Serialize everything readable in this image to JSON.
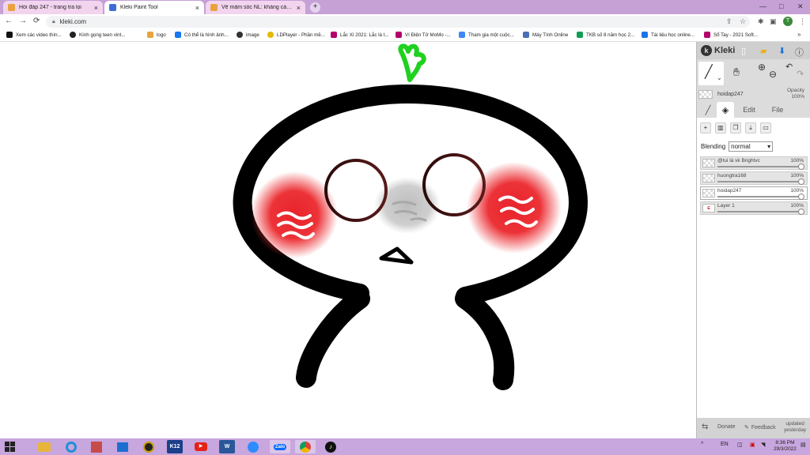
{
  "browser": {
    "tabs": [
      {
        "label": "Hỏi đáp 247 - trang tra lọi",
        "icon": "hoidap-favicon",
        "color": "#e8a33d"
      },
      {
        "label": "Kleki Paint Tool",
        "icon": "kleki-favicon",
        "color": "#3b6fd6"
      },
      {
        "label": "Vẽ mầm sốc NL: kháng cáo chỗ",
        "icon": "hoidap-favicon",
        "color": "#e8a33d"
      }
    ],
    "tab_close": "×",
    "new_tab": "+",
    "url": "kleki.com",
    "profile_initial": "T",
    "window_controls": {
      "minimize": "—",
      "maximize": "□",
      "close": "✕"
    },
    "bookmarks": [
      {
        "label": "Xem các video thín...",
        "color": "#111"
      },
      {
        "label": "Kính gọng teen vint...",
        "color": "#222"
      },
      {
        "label": "logo",
        "color": "#e8a33d"
      },
      {
        "label": "Có thể là hình ảnh...",
        "color": "#1877f2"
      },
      {
        "label": "image",
        "color": "#333"
      },
      {
        "label": "LDPlayer - Phần mề...",
        "color": "#e6b800"
      },
      {
        "label": "Lắc Xì 2021: Lắc là t...",
        "color": "#b5006b"
      },
      {
        "label": "Ví Điện Tử MoMo -...",
        "color": "#b5006b"
      },
      {
        "label": "Tham gia một cuộc...",
        "color": "#4285f4"
      },
      {
        "label": "Máy Tính Online",
        "color": "#4a6fb5"
      },
      {
        "label": "TKB số 8 năm học 2...",
        "color": "#0f9d58"
      },
      {
        "label": "Tài liệu học online...",
        "color": "#1a73e8"
      },
      {
        "label": "Sổ Tay - 2021 Soft...",
        "color": "#b5006b"
      }
    ]
  },
  "kleki": {
    "logo": "Kleki",
    "layer_preview_name": "hoidap247",
    "opacity_label": "Opacity",
    "opacity_value": "100%",
    "tabs": {
      "edit": "Edit",
      "file": "File"
    },
    "blending_label": "Blending",
    "blending_value": "normal",
    "layers": [
      {
        "name": "@tui là vk Brightvc",
        "opacity": "100%",
        "selected": false
      },
      {
        "name": "huongtra168",
        "opacity": "100%",
        "selected": false
      },
      {
        "name": "hoidap247",
        "opacity": "100%",
        "selected": true
      },
      {
        "name": "Layer 1",
        "opacity": "100%",
        "selected": false
      }
    ],
    "footer": {
      "donate": "Donate",
      "feedback": "Feedback",
      "updated": "updated",
      "updated_when": "yesterday"
    }
  },
  "taskbar": {
    "apps": [
      {
        "label": "",
        "icon": "file-explorer-icon",
        "color": "#e8b43a"
      },
      {
        "label": "",
        "icon": "internet-explorer-icon",
        "color": "#1e90d6"
      },
      {
        "label": "",
        "icon": "store-icon",
        "color": "#c84b4b"
      },
      {
        "label": "",
        "icon": "mail-icon",
        "color": "#1c6fd1"
      },
      {
        "label": "",
        "icon": "game-icon",
        "color": "#222"
      },
      {
        "label": "K12",
        "icon": "k12-icon",
        "color": "#1c3f8a"
      },
      {
        "label": "",
        "icon": "youtube-icon",
        "color": "#e62117"
      },
      {
        "label": "W",
        "icon": "word-icon",
        "color": "#2b579a"
      },
      {
        "label": "",
        "icon": "zoom-icon",
        "color": "#2d8cff"
      },
      {
        "label": "Zalo",
        "icon": "zalo-icon",
        "color": "#0068ff"
      },
      {
        "label": "",
        "icon": "chrome-icon",
        "color": "#4caf50"
      },
      {
        "label": "",
        "icon": "tiktok-icon",
        "color": "#111"
      }
    ],
    "language": "EN",
    "time": "8:36 PM",
    "date": "29/3/2022"
  }
}
